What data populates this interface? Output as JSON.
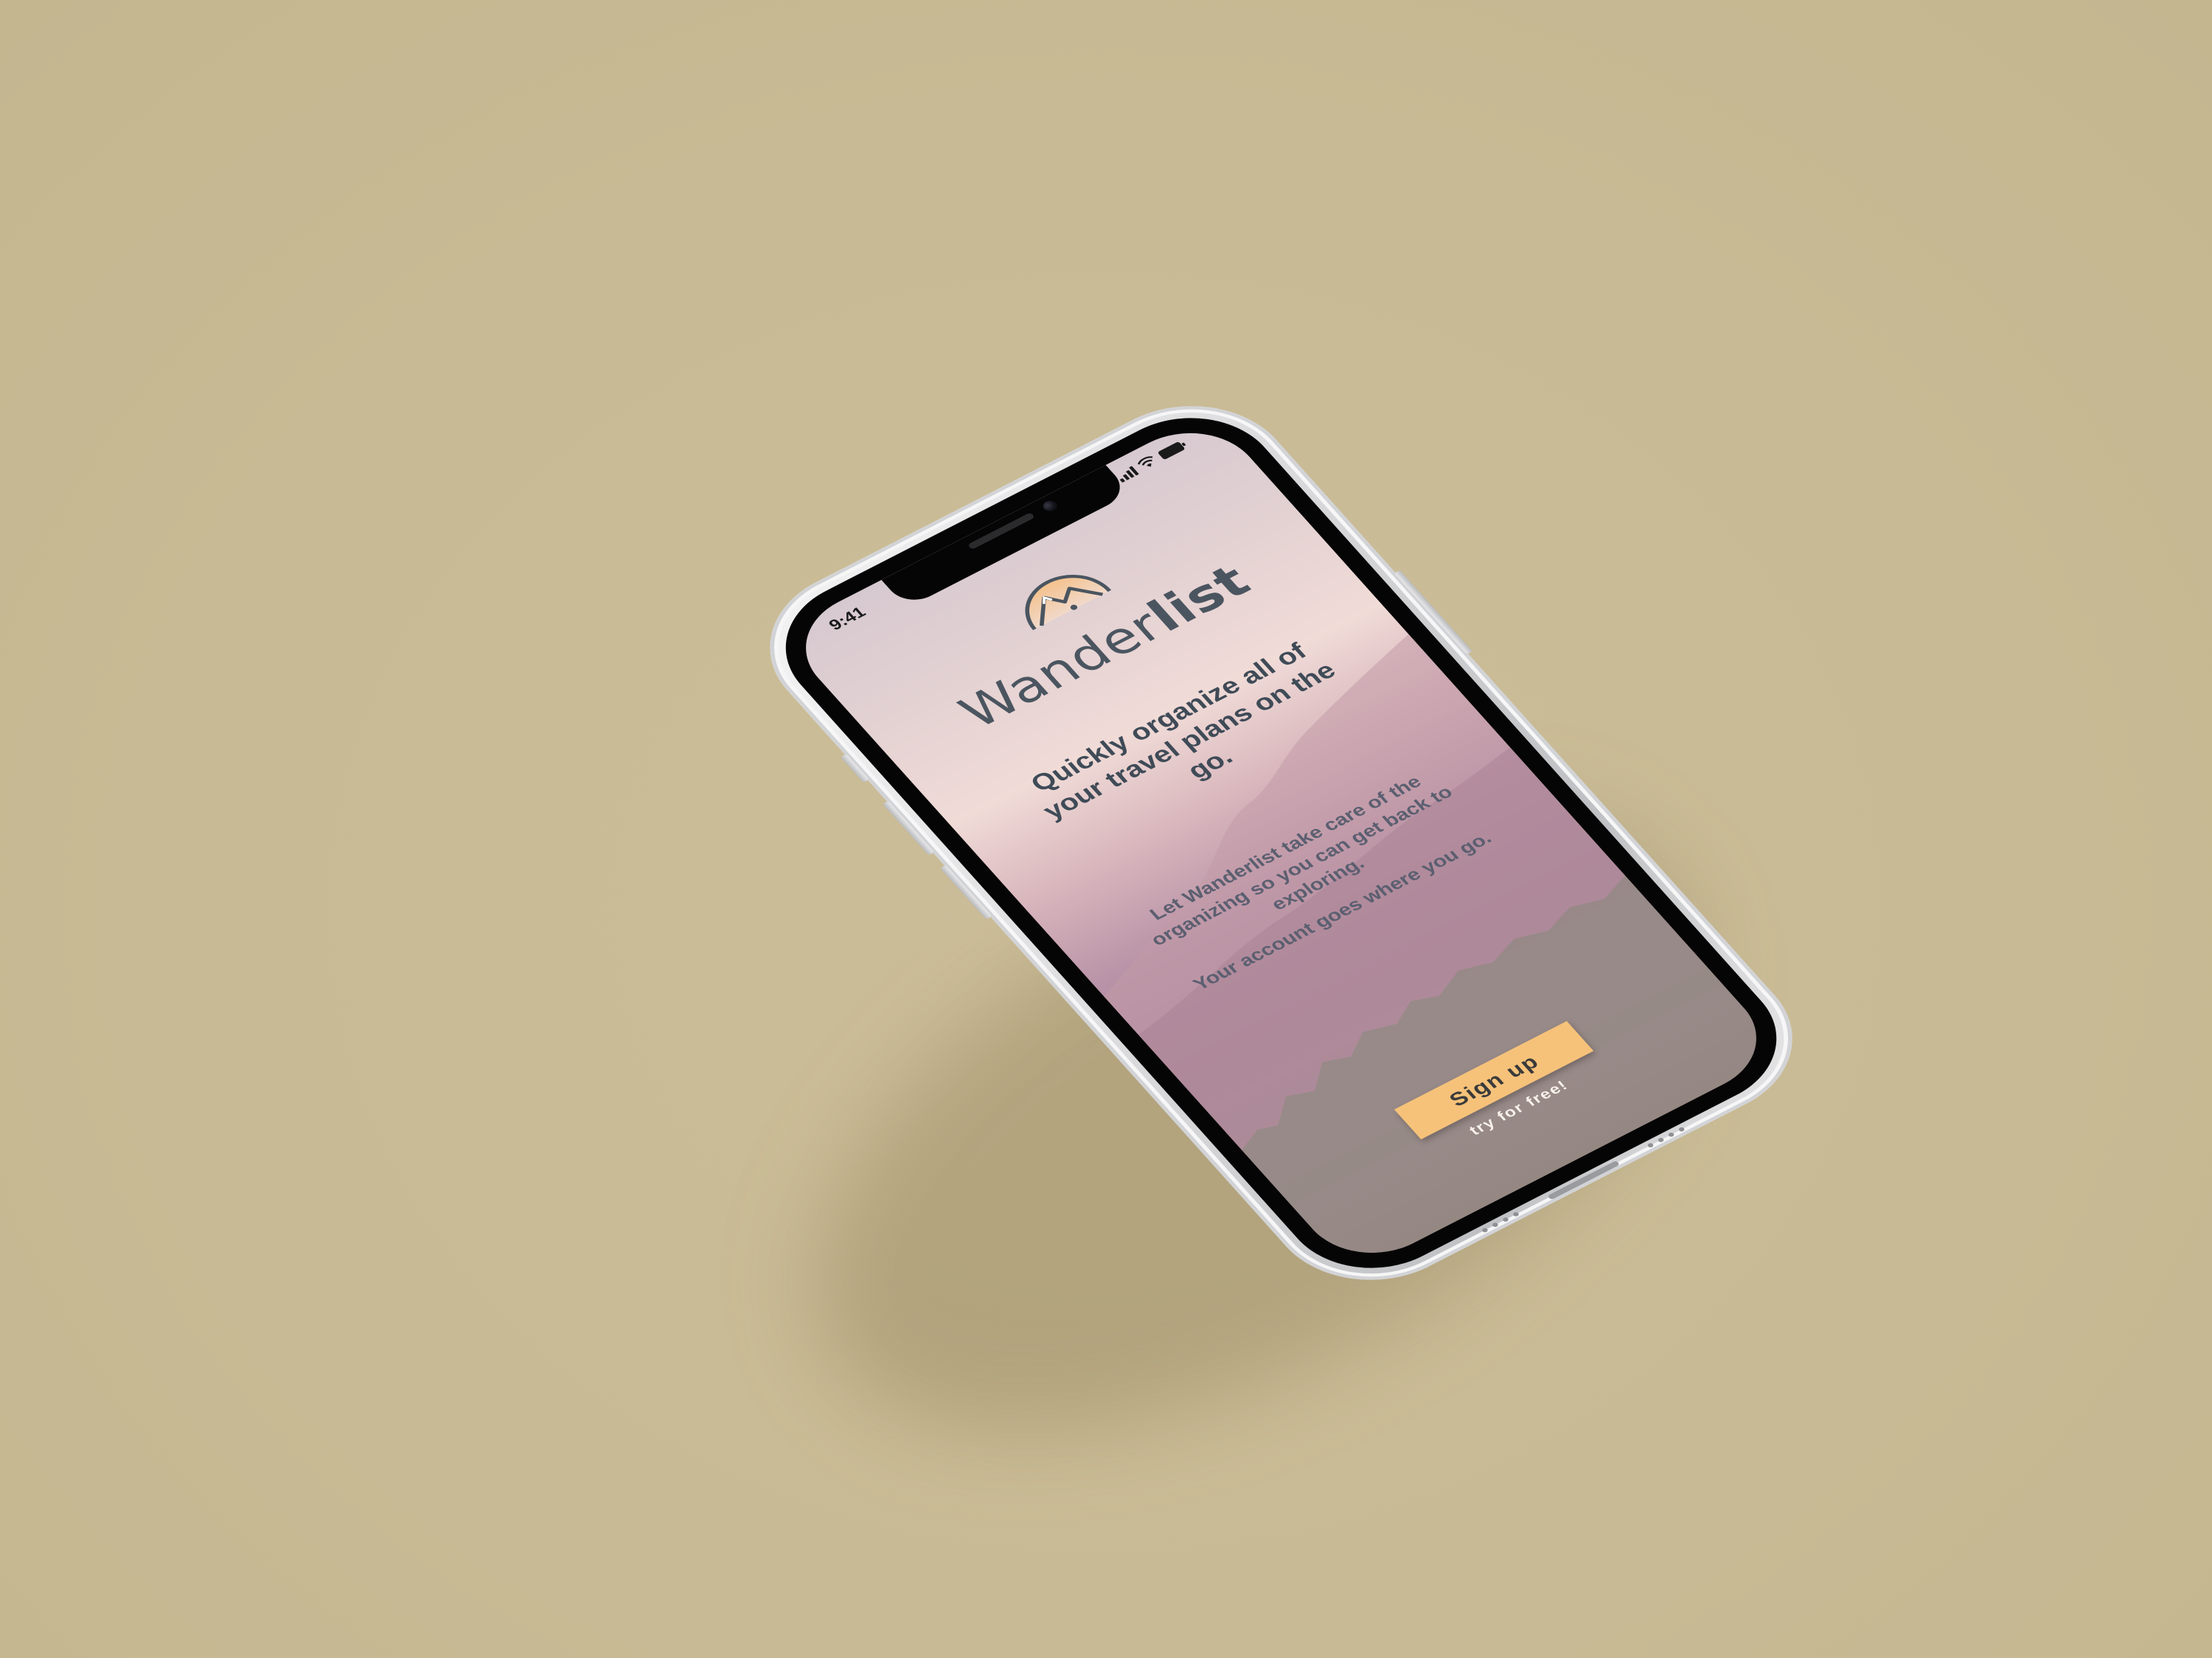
{
  "status_bar": {
    "time": "9:41"
  },
  "brand": {
    "name_light": "Wander",
    "name_bold": "list"
  },
  "headline": "Quickly organize all of your travel plans on the go.",
  "body": {
    "paragraph_1": "Let Wanderlist take care of the organizing so you can get back to exploring.",
    "paragraph_2": "Your account goes where you go."
  },
  "cta": {
    "signup_label": "Sign up",
    "subtext": "try for free!"
  },
  "colors": {
    "background": "#c9bb96",
    "button": "#f6c27a",
    "brand_text": "#4a5560"
  },
  "icons": [
    "signal-icon",
    "wifi-icon",
    "battery-icon",
    "mountain-logo-icon"
  ]
}
